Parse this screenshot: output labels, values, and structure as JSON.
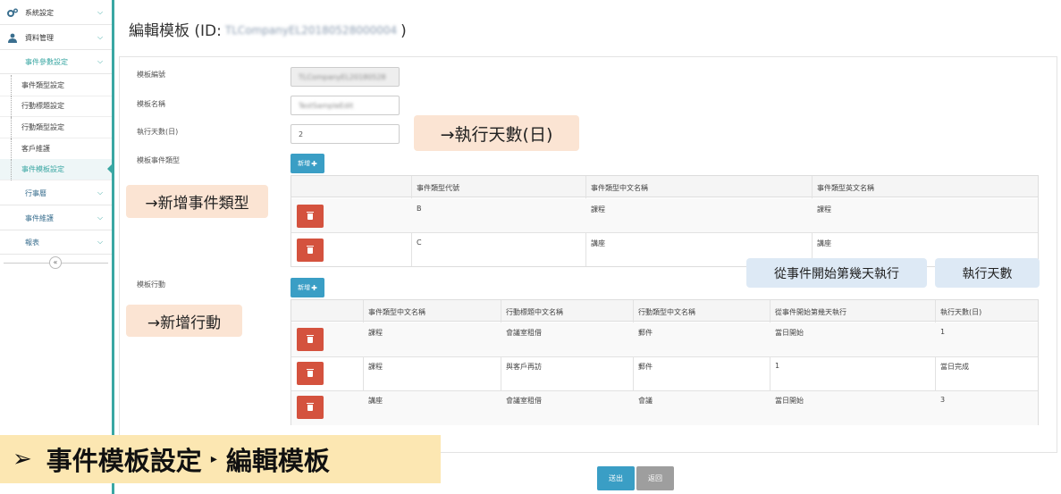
{
  "sidebar": {
    "system_settings": "系統設定",
    "data_management": "資料管理",
    "event_param_settings": "事件參數設定",
    "leaves": [
      "事件類型設定",
      "行動標題設定",
      "行動類型設定",
      "客戶維護",
      "事件模板設定"
    ],
    "schedule": "行事曆",
    "event_maintenance": "事件維護",
    "reports": "報表",
    "collapse_symbol": "«"
  },
  "header": {
    "title_prefix": "編輯模板 (ID:",
    "template_id": "TLCompanyEL20180528000004",
    "title_suffix": ")"
  },
  "form": {
    "template_no_label": "模板編號",
    "template_no_value": "TLCompanyEL20180528",
    "template_name_label": "模板名稱",
    "template_name_value": "TestSampleEdit",
    "exec_days_label": "執行天數(日)",
    "exec_days_value": "2",
    "event_types_label": "模板事件類型",
    "actions_label": "模板行動",
    "add_label": "新增",
    "add_plus": "✚"
  },
  "event_type_table": {
    "headers": [
      "事件類型代號",
      "事件類型中文名稱",
      "事件類型英文名稱"
    ],
    "rows": [
      [
        "B",
        "課程",
        "課程"
      ],
      [
        "C",
        "講座",
        "講座"
      ]
    ]
  },
  "action_table": {
    "headers": [
      "事件類型中文名稱",
      "行動標題中文名稱",
      "行動類型中文名稱",
      "從事件開始第幾天執行",
      "執行天數(日)"
    ],
    "rows": [
      [
        "課程",
        "會議室租借",
        "郵件",
        "當日開始",
        "1"
      ],
      [
        "課程",
        "與客戶再訪",
        "郵件",
        "1",
        "當日完成"
      ],
      [
        "講座",
        "會議室租借",
        "會議",
        "當日開始",
        "3"
      ]
    ]
  },
  "annotations": {
    "exec_days": "→執行天數(日)",
    "add_event_type": "→新增事件類型",
    "add_action": "→新增行動",
    "start_day": "從事件開始第幾天執行",
    "exec_count": "執行天數"
  },
  "banner": {
    "arrow": "➢",
    "part1": "事件模板設定",
    "sep": "▸",
    "part2": "編輯模板"
  },
  "buttons": {
    "submit": "送出",
    "back": "返回"
  },
  "colors": {
    "accent": "#3aa7a3",
    "primary_button": "#3a9ec5",
    "danger_button": "#d4523e",
    "banner": "#fce7b2",
    "callout_orange": "#fbe4d3",
    "callout_blue": "#dde9f5"
  }
}
